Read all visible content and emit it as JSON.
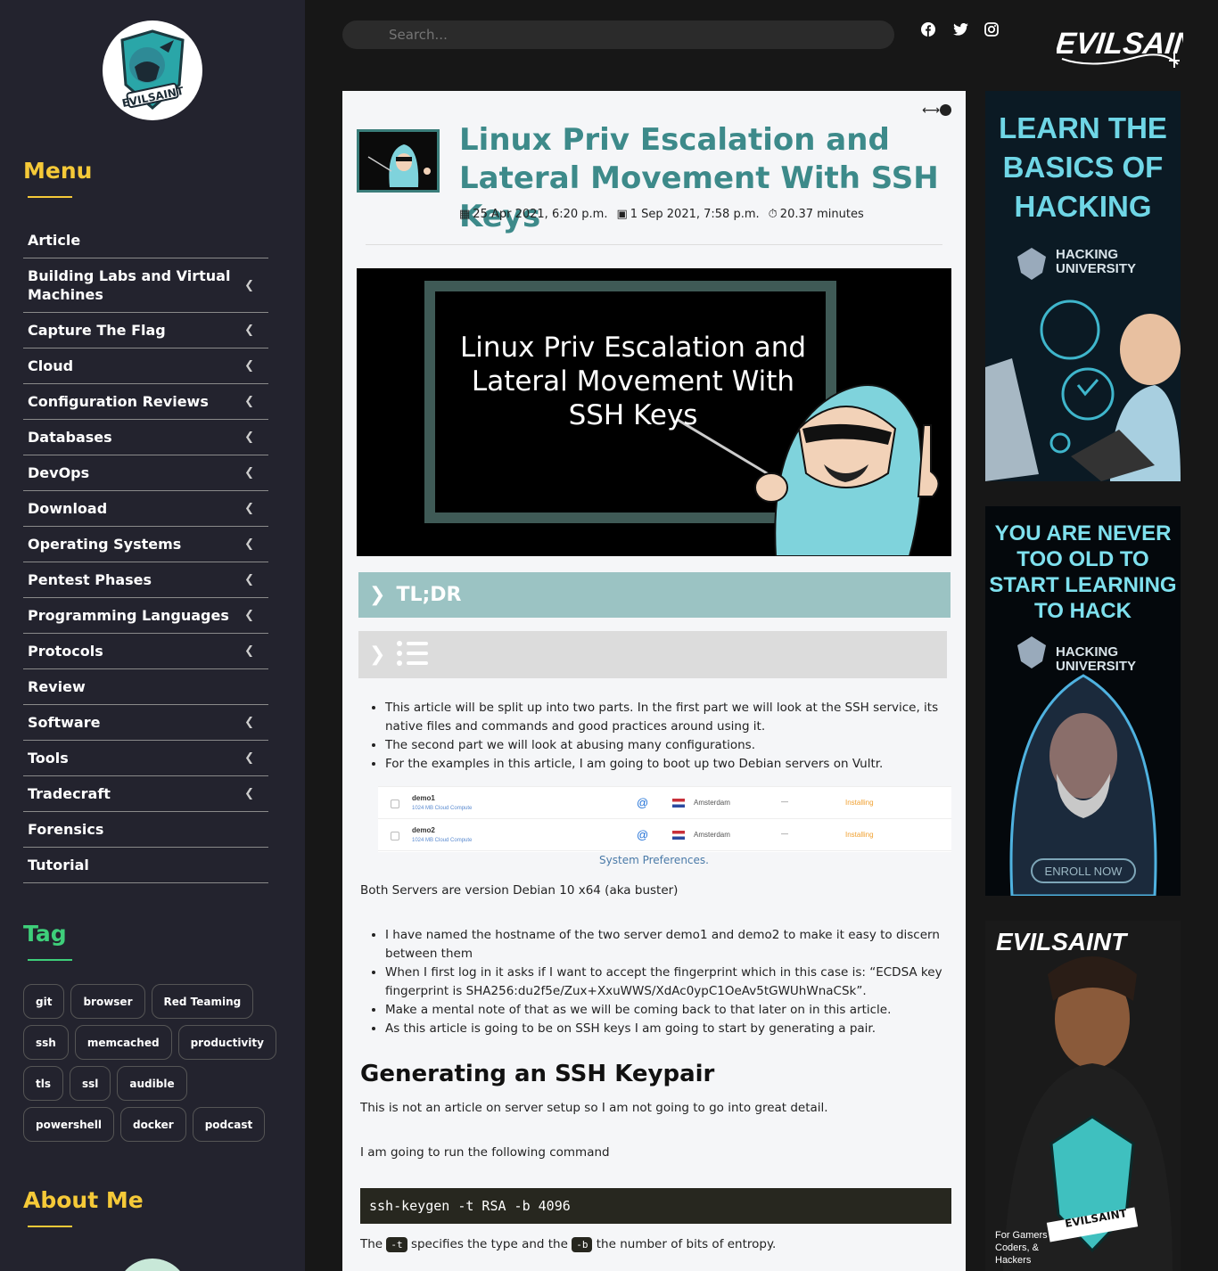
{
  "sidebar": {
    "menu_heading": "Menu",
    "menu_items": [
      {
        "label": "Article",
        "has_children": false
      },
      {
        "label": "Building Labs and Virtual Machines",
        "has_children": true
      },
      {
        "label": "Capture The Flag",
        "has_children": true
      },
      {
        "label": "Cloud",
        "has_children": true
      },
      {
        "label": "Configuration Reviews",
        "has_children": true
      },
      {
        "label": "Databases",
        "has_children": true
      },
      {
        "label": "DevOps",
        "has_children": true
      },
      {
        "label": "Download",
        "has_children": true
      },
      {
        "label": "Operating Systems",
        "has_children": true
      },
      {
        "label": "Pentest Phases",
        "has_children": true
      },
      {
        "label": "Programming Languages",
        "has_children": true
      },
      {
        "label": "Protocols",
        "has_children": true
      },
      {
        "label": "Review",
        "has_children": false
      },
      {
        "label": "Software",
        "has_children": true
      },
      {
        "label": "Tools",
        "has_children": true
      },
      {
        "label": "Tradecraft",
        "has_children": true
      },
      {
        "label": "Forensics",
        "has_children": false
      },
      {
        "label": "Tutorial",
        "has_children": false
      }
    ],
    "tag_heading": "Tag",
    "tags": [
      "git",
      "browser",
      "Red Teaming",
      "ssh",
      "memcached",
      "productivity",
      "tls",
      "ssl",
      "audible",
      "powershell",
      "docker",
      "podcast"
    ],
    "about_heading": "About Me",
    "colors": {
      "menu_heading": "#f5c938",
      "tag_heading": "#3ecf7a"
    }
  },
  "header": {
    "search_placeholder": "Search...",
    "social_icons": [
      "facebook-icon",
      "twitter-icon",
      "instagram-icon"
    ],
    "brand": "EVILSAINT"
  },
  "article": {
    "title": "Linux Priv Escalation and Lateral Movement With SSH Keys",
    "published": "25 Apr 2021, 6:20 p.m.",
    "updated": "1 Sep 2021, 7:58 p.m.",
    "read_time": "20.37 minutes",
    "banner_text": "Linux Priv Escalation and Lateral Movement With SSH Keys",
    "tldr_label": "TL;DR",
    "intro_bullets": [
      "This article will be split up into two parts. In the first part we will look at the SSH service, its native files and commands and good practices around using it.",
      "The second part we will look at abusing many configurations.",
      "For the examples in this article, I am going to boot up two Debian servers on Vultr."
    ],
    "servers": [
      {
        "name": "demo1",
        "spec": "1024 MB Cloud Compute",
        "location": "Amsterdam",
        "dash": "—",
        "status": "Installing"
      },
      {
        "name": "demo2",
        "spec": "1024 MB Cloud Compute",
        "location": "Amsterdam",
        "dash": "—",
        "status": "Installing"
      }
    ],
    "figure_caption": "System Preferences.",
    "servers_version": "Both Servers are version Debian 10 x64 (aka buster)",
    "bullets2": [
      "I have named the hostname of the two server demo1 and demo2 to make it easy to discern between them",
      "When I first log in it asks if I want to accept the fingerprint which in this case is: “ECDSA key fingerprint is SHA256:du2f5e/Zux+XxuWWS/XdAc0ypC1OeAv5tGWUhWnaCSk”.",
      "Make a mental note of that as we will be coming back to that later on in this article.",
      "As this article is going to be on SSH keys I am going to start by generating a pair."
    ],
    "h2": "Generating an SSH Keypair",
    "p1": "This is not an article on server setup so I am not going to go into great detail.",
    "p2": "I am going to run the following command",
    "code": "ssh-keygen -t RSA -b 4096",
    "p3_a": "The",
    "p3_code1": "-t",
    "p3_b": "specifies the type and the",
    "p3_code2": "-b",
    "p3_c": "the number of bits of entropy."
  },
  "ads": [
    {
      "lines": [
        "LEARN THE",
        "BASICS OF",
        "HACKING"
      ],
      "brand_1": "HACKING",
      "brand_2": "UNIVERSITY"
    },
    {
      "lines": [
        "YOU ARE NEVER",
        "TOO OLD TO",
        "START LEARNING",
        "TO HACK"
      ],
      "brand_1": "HACKING",
      "brand_2": "UNIVERSITY",
      "cta": "ENROLL NOW"
    },
    {
      "brand": "EVILSAINT",
      "tagline": [
        "For Gamers",
        "Coders, &",
        "Hackers"
      ],
      "logo_text": "EVILSAINT"
    }
  ]
}
